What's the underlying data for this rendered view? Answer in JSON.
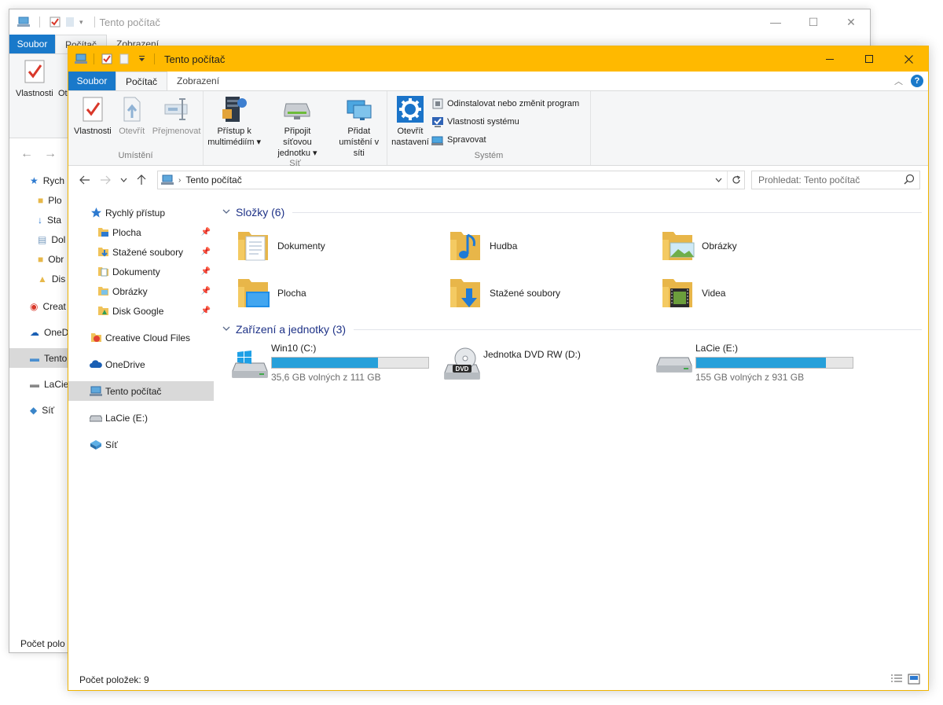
{
  "background_window": {
    "title": "Tento počítač",
    "tabs": [
      "Soubor",
      "Počítač",
      "Zobrazení"
    ],
    "ribbon_labels": [
      "Vlastnosti",
      "Ot"
    ],
    "nav_items": [
      "Rych",
      "Plo",
      "Sta",
      "Dol",
      "Obr",
      "Dis",
      "Creat",
      "OneD",
      "Tento",
      "LaCie",
      "Síť"
    ],
    "status": "Počet polo"
  },
  "window": {
    "title": "Tento počítač",
    "accent_color": "#ffb900",
    "controls": {
      "minimize": "minimize-icon",
      "maximize": "maximize-icon",
      "close": "close-icon"
    }
  },
  "tabs": {
    "file": "Soubor",
    "computer": "Počítač",
    "view": "Zobrazení"
  },
  "ribbon": {
    "location_group": {
      "label": "Umístění",
      "properties": "Vlastnosti",
      "open": "Otevřít",
      "rename": "Přejmenovat"
    },
    "network_group": {
      "label": "Síť",
      "media_line1": "Přístup k",
      "media_line2": "multimédiím ▾",
      "map_line1": "Připojit síťovou",
      "map_line2": "jednotku ▾",
      "add_line1": "Přidat",
      "add_line2": "umístění v síti"
    },
    "system_group": {
      "label": "Systém",
      "settings_line1": "Otevřít",
      "settings_line2": "nastavení",
      "uninstall": "Odinstalovat nebo změnit program",
      "system_properties": "Vlastnosti systému",
      "manage": "Spravovat"
    }
  },
  "address_bar": {
    "path": "Tento počítač",
    "search_placeholder": "Prohledat: Tento počítač"
  },
  "nav_pane": {
    "quick_access": "Rychlý přístup",
    "pinned": [
      "Plocha",
      "Stažené soubory",
      "Dokumenty",
      "Obrázky",
      "Disk Google"
    ],
    "creative_cloud": "Creative Cloud Files",
    "onedrive": "OneDrive",
    "this_pc": "Tento počítač",
    "lacie": "LaCie (E:)",
    "network": "Síť"
  },
  "folders": {
    "header": "Složky (6)",
    "items": [
      "Dokumenty",
      "Hudba",
      "Obrázky",
      "Plocha",
      "Stažené soubory",
      "Videa"
    ]
  },
  "devices": {
    "header": "Zařízení a jednotky (3)",
    "items": [
      {
        "name": "Win10 (C:)",
        "free_text": "35,6 GB volných z 111 GB",
        "used_fraction": 0.68
      },
      {
        "name": "Jednotka DVD RW (D:)"
      },
      {
        "name": "LaCie (E:)",
        "free_text": "155 GB volných z 931 GB",
        "used_fraction": 0.83
      }
    ]
  },
  "status_bar": {
    "item_count": "Počet položek: 9"
  }
}
